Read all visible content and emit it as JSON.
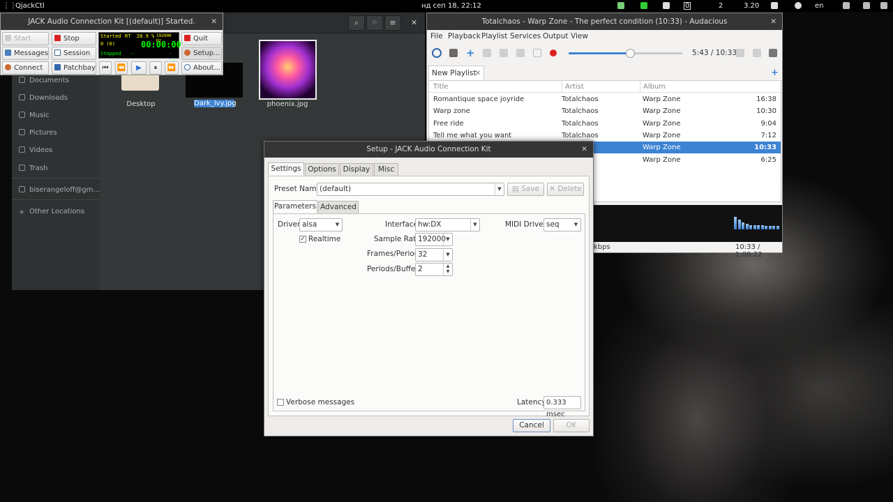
{
  "topbar": {
    "activities": "QjackCtl",
    "clock": "нд сеп 18, 22:12",
    "mem": "0",
    "users": "2",
    "version": "3.20",
    "lang": "en"
  },
  "nautilus": {
    "sidebar": [
      "Documents",
      "Downloads",
      "Music",
      "Pictures",
      "Videos",
      "Trash",
      "biserangeloff@gm...",
      "Other Locations"
    ],
    "files": [
      {
        "name": "Desktop"
      },
      {
        "name": "Dark_Ivy.jpg"
      },
      {
        "name": "phoenix.jpg"
      }
    ]
  },
  "qjack": {
    "title": "JACK Audio Connection Kit [(default)] Started.",
    "buttons": {
      "start": "Start",
      "stop": "Stop",
      "quit": "Quit",
      "messages": "Messages",
      "session": "Session",
      "setup": "Setup...",
      "connect": "Connect",
      "patchbay": "Patchbay",
      "about": "About..."
    },
    "lcd": {
      "state": "Started",
      "rt": "RT",
      "dsp": "20.9 %",
      "rate": "192000 Hz",
      "xruns": "0 (0)",
      "time": "00:00:00",
      "transport": "Stopped",
      "dash1": "--",
      "dash2": "--:--"
    }
  },
  "audacious": {
    "title": "Totalchaos - Warp Zone - The perfect condition (10:33) - Audacious",
    "menu": [
      "File",
      "Playback",
      "Playlist",
      "Services",
      "Output",
      "View"
    ],
    "time": "5:43 / 10:33",
    "seek_fraction": 0.54,
    "tab": "New Playlist",
    "columns": [
      "Title",
      "Artist",
      "Album"
    ],
    "rows": [
      {
        "title": "Romantique space joyride",
        "artist": "Totalchaos",
        "album": "Warp Zone",
        "length": "16:38"
      },
      {
        "title": "Warp zone",
        "artist": "Totalchaos",
        "album": "Warp Zone",
        "length": "10:30"
      },
      {
        "title": "Free ride",
        "artist": "Totalchaos",
        "album": "Warp Zone",
        "length": "9:04"
      },
      {
        "title": "Tell me what you want",
        "artist": "Totalchaos",
        "album": "Warp Zone",
        "length": "7:12"
      },
      {
        "title": "",
        "artist": "",
        "album": "Warp Zone",
        "length": "10:33"
      },
      {
        "title": "",
        "artist": "",
        "album": "Warp Zone",
        "length": "6:25"
      }
    ],
    "status_left": "kbps",
    "status_right": "10:33 / 1:00:22",
    "accent": "#3d83d3"
  },
  "dialog": {
    "title": "Setup - JACK Audio Connection Kit",
    "tabs": [
      "Settings",
      "Options",
      "Display",
      "Misc"
    ],
    "preset_label": "Preset Name:",
    "preset_value": "(default)",
    "save": "Save",
    "delete": "Delete",
    "subtabs": [
      "Parameters",
      "Advanced"
    ],
    "driver_label": "Driver:",
    "driver": "alsa",
    "realtime_label": "Realtime",
    "interface_label": "Interface:",
    "interface": "hw:DX",
    "midi_label": "MIDI Driver:",
    "midi": "seq",
    "rate_label": "Sample Rate:",
    "rate": "192000",
    "frames_label": "Frames/Period:",
    "frames": "32",
    "periods_label": "Periods/Buffer:",
    "periods": "2",
    "verbose_label": "Verbose messages",
    "latency_label": "Latency:",
    "latency": "0.333 msec",
    "cancel": "Cancel",
    "ok": "OK"
  }
}
